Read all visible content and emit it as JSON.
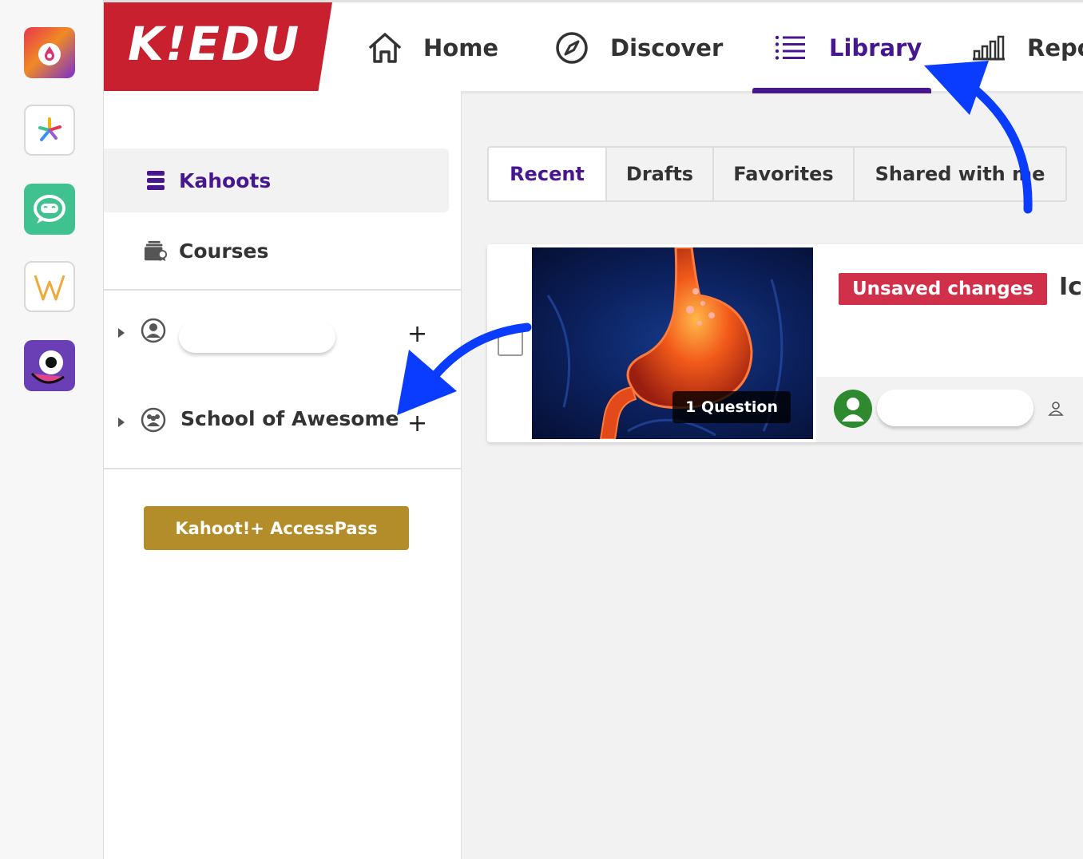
{
  "brand": {
    "logo_text": "K!EDU",
    "color": "#c8202f"
  },
  "nav": {
    "home_label": "Home",
    "discover_label": "Discover",
    "library_label": "Library",
    "reports_label": "Repo",
    "active": "Library",
    "accent_color": "#46178f"
  },
  "rail": {
    "apps": [
      {
        "icon": "drop-app-icon"
      },
      {
        "icon": "pinwheel-app-icon"
      },
      {
        "icon": "chat-bot-app-icon"
      },
      {
        "icon": "w-letter-app-icon"
      },
      {
        "icon": "one-eyed-monster-app-icon"
      }
    ]
  },
  "sidebar": {
    "kahoots_label": "Kahoots",
    "courses_label": "Courses",
    "folders": [
      {
        "name": "",
        "icon": "user-circle-icon",
        "add_icon": "+"
      },
      {
        "name": "School of Awesome",
        "icon": "group-icon",
        "add_icon": "+"
      }
    ],
    "accesspass_label": "Kahoot!+ AccessPass",
    "accesspass_color": "#b38d2a"
  },
  "tabs": {
    "items": [
      "Recent",
      "Drafts",
      "Favorites",
      "Shared with me"
    ],
    "active": "Recent"
  },
  "card": {
    "question_count": "1 Question",
    "status_badge": "Unsaved changes",
    "status_color": "#d0304a",
    "title": "Ic",
    "owner_name": "",
    "thumbnail": "stomach-illustration"
  },
  "annotations": {
    "arrow_color": "#0a3cff",
    "arrows": [
      "arrow-to-library",
      "arrow-to-school-folder"
    ]
  }
}
